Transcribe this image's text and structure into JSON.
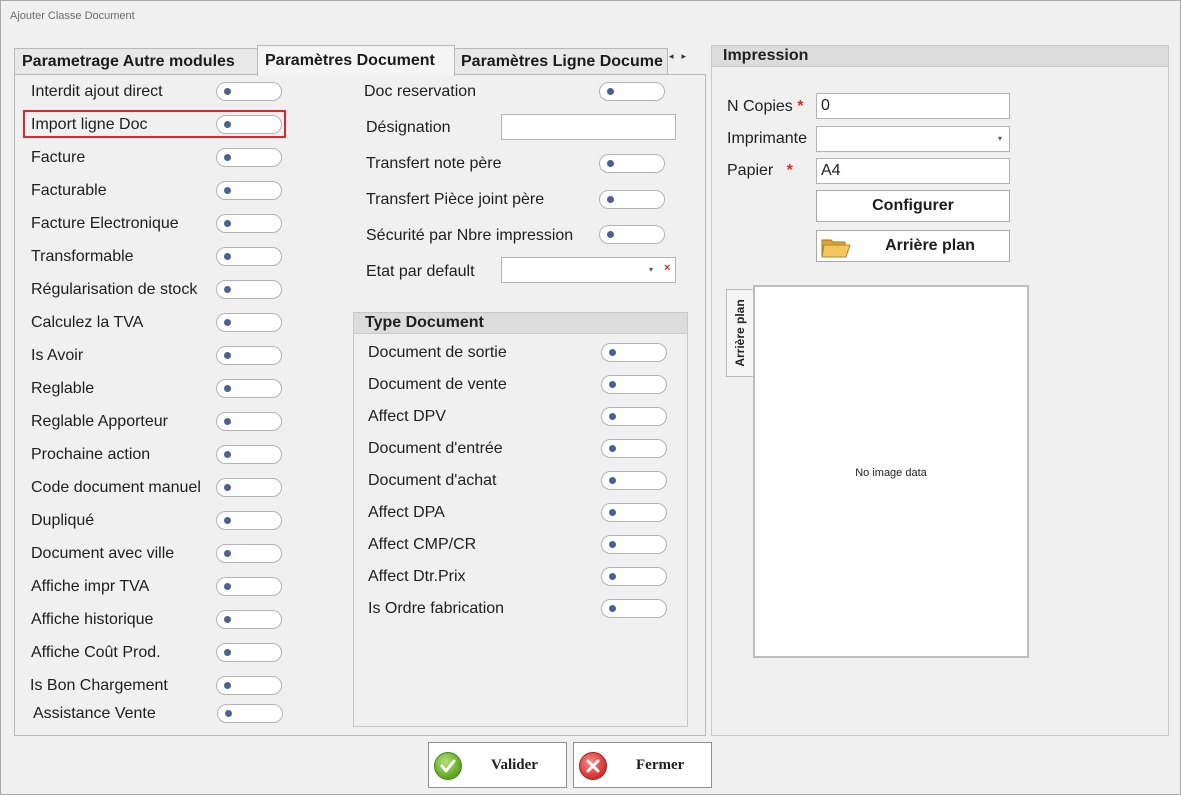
{
  "window": {
    "title": "Ajouter Classe Document"
  },
  "tabs": [
    {
      "label": "Parametrage Autre modules",
      "active": false
    },
    {
      "label": "Paramètres Document",
      "active": true
    },
    {
      "label": "Paramètres Ligne Docume",
      "active": false
    }
  ],
  "tab_scroll": {
    "left": "◂",
    "right": "▸"
  },
  "left_toggles": [
    "Interdit ajout direct",
    "Import ligne Doc",
    "Facture",
    "Facturable",
    "Facture Electronique",
    "Transformable",
    "Régularisation de stock",
    "Calculez la TVA",
    "Is Avoir",
    "Reglable",
    "Reglable Apporteur",
    "Prochaine action",
    "Code document manuel",
    "Dupliqué",
    "Document avec ville",
    "Affiche impr TVA",
    "Affiche historique",
    "Affiche Coût Prod.",
    "Is Bon Chargement",
    "Assistance Vente"
  ],
  "middle": {
    "doc_reservation": "Doc reservation",
    "designation": "Désignation",
    "designation_value": "",
    "transfert_note": "Transfert note père",
    "transfert_piece": "Transfert Pièce joint père",
    "securite": "Sécurité par Nbre impression",
    "etat_defaut": "Etat par default",
    "etat_value": ""
  },
  "type_document": {
    "title": "Type Document",
    "items": [
      "Document de sortie",
      "Document de vente",
      "Affect DPV",
      "Document d'entrée",
      "Document d'achat",
      "Affect DPA",
      "Affect CMP/CR",
      "Affect Dtr.Prix",
      "Is Ordre fabrication"
    ]
  },
  "impression": {
    "title": "Impression",
    "n_copies_label": "N Copies",
    "n_copies_value": "0",
    "imprimante_label": "Imprimante",
    "imprimante_value": "",
    "papier_label": "Papier",
    "papier_value": "A4",
    "required_mark": "*",
    "configurer": "Configurer",
    "arriere_plan_btn": "Arrière plan",
    "arriere_plan_tab": "Arrière plan",
    "no_image": "No image data"
  },
  "footer": {
    "valider": "Valider",
    "fermer": "Fermer"
  },
  "icons": {
    "toggle_knob": "dot",
    "combo_arrow": "▾",
    "clear": "×",
    "folder": "folder-icon",
    "valider": "check-icon",
    "fermer": "close-icon"
  },
  "colors": {
    "highlight": "#e0252b",
    "knob": "#4a6194",
    "required": "#d32f2f"
  }
}
